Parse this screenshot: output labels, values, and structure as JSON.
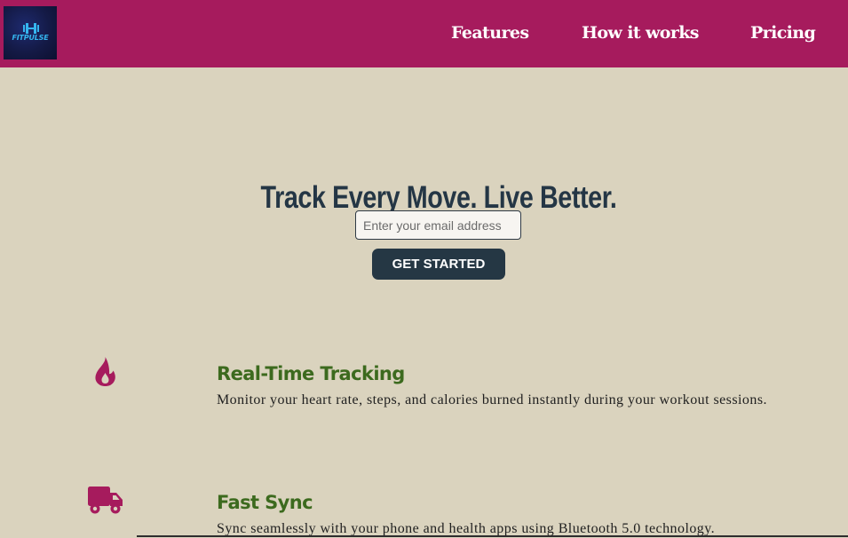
{
  "brand": {
    "logo_text": "FITPULSE"
  },
  "nav": {
    "items": [
      {
        "label": "Features"
      },
      {
        "label": "How it works"
      },
      {
        "label": "Pricing"
      }
    ]
  },
  "hero": {
    "title": "Track Every Move. Live Better.",
    "email_placeholder": "Enter your email address",
    "cta_label": "GET STARTED"
  },
  "features": [
    {
      "icon": "fire-icon",
      "title": "Real-Time Tracking",
      "description": "Monitor your heart rate, steps, and calories burned instantly during your workout sessions."
    },
    {
      "icon": "truck-icon",
      "title": "Fast Sync",
      "description": "Sync seamlessly with your phone and health apps using Bluetooth 5.0 technology."
    }
  ],
  "colors": {
    "header_bg": "#a61b5d",
    "page_bg": "#dad3be",
    "title_color": "#243645",
    "button_bg": "#253744",
    "feature_title_color": "#3c6a1e",
    "icon_color": "#a61b5d"
  }
}
